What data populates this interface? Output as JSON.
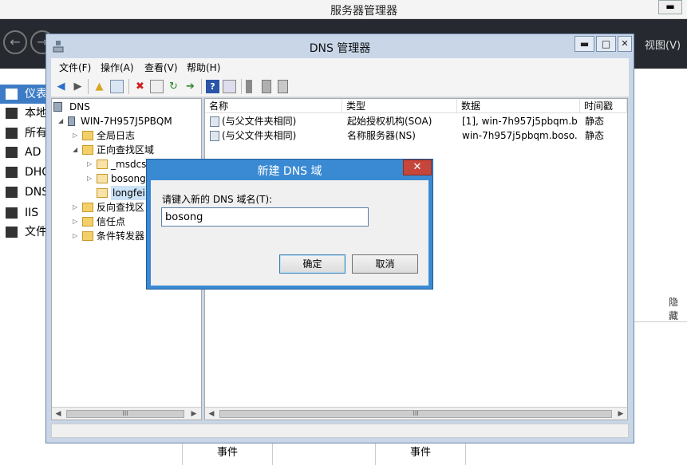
{
  "server_manager": {
    "title": "服务器管理器",
    "minimize_label": "▬",
    "back_label": "←",
    "forward_label": "→",
    "view_menu": "视图(V)",
    "sidebar": [
      {
        "label": "仪表",
        "active": true
      },
      {
        "label": "本地"
      },
      {
        "label": "所有"
      },
      {
        "label": "AD D"
      },
      {
        "label": "DHC"
      },
      {
        "label": "DNS"
      },
      {
        "label": "IIS"
      },
      {
        "label": "文件"
      }
    ],
    "right_text": "隐藏",
    "bottom_panels": [
      "事件",
      "事件"
    ]
  },
  "dns_window": {
    "title": "DNS 管理器",
    "controls": {
      "minimize": "▬",
      "maximize": "□",
      "close": "✕"
    },
    "menu": [
      "文件(F)",
      "操作(A)",
      "查看(V)",
      "帮助(H)"
    ],
    "toolbar_icons": [
      "back-icon",
      "forward-icon",
      "up-folder-icon",
      "show-hide-tree-icon",
      "delete-icon",
      "properties-icon",
      "refresh-icon",
      "export-icon",
      "help-icon",
      "console-icon",
      "record-icon",
      "zone-icon",
      "server-icon"
    ],
    "tree": {
      "root": "DNS",
      "server": "WIN-7H957J5PBQM",
      "items": [
        {
          "label": "全局日志",
          "level": 2
        },
        {
          "label": "正向查找区域",
          "level": 2,
          "expanded": true
        },
        {
          "label": "_msdcs",
          "level": 3
        },
        {
          "label": "bosong",
          "level": 3
        },
        {
          "label": "longfei",
          "level": 3,
          "selected": true
        },
        {
          "label": "反向查找区",
          "level": 2
        },
        {
          "label": "信任点",
          "level": 2
        },
        {
          "label": "条件转发器",
          "level": 2
        }
      ],
      "scroll_thumb": "III"
    },
    "list": {
      "columns": [
        "名称",
        "类型",
        "数据",
        "时间戳"
      ],
      "rows": [
        {
          "name": "(与父文件夹相同)",
          "type": "起始授权机构(SOA)",
          "data": "[1], win-7h957j5pbqm.b...",
          "timestamp": "静态"
        },
        {
          "name": "(与父文件夹相同)",
          "type": "名称服务器(NS)",
          "data": "win-7h957j5pbqm.boso...",
          "timestamp": "静态"
        }
      ],
      "scroll_thumb": "III"
    }
  },
  "dialog": {
    "title": "新建 DNS 域",
    "close_label": "✕",
    "label": "请键入新的 DNS 域名(T):",
    "input_value": "bosong",
    "ok_label": "确定",
    "cancel_label": "取消"
  },
  "colors": {
    "dialog_title": "#3a8ad3",
    "close_red": "#c7463b",
    "window_frame": "#c8d6e8",
    "sidebar_active": "#3d7cc5"
  }
}
